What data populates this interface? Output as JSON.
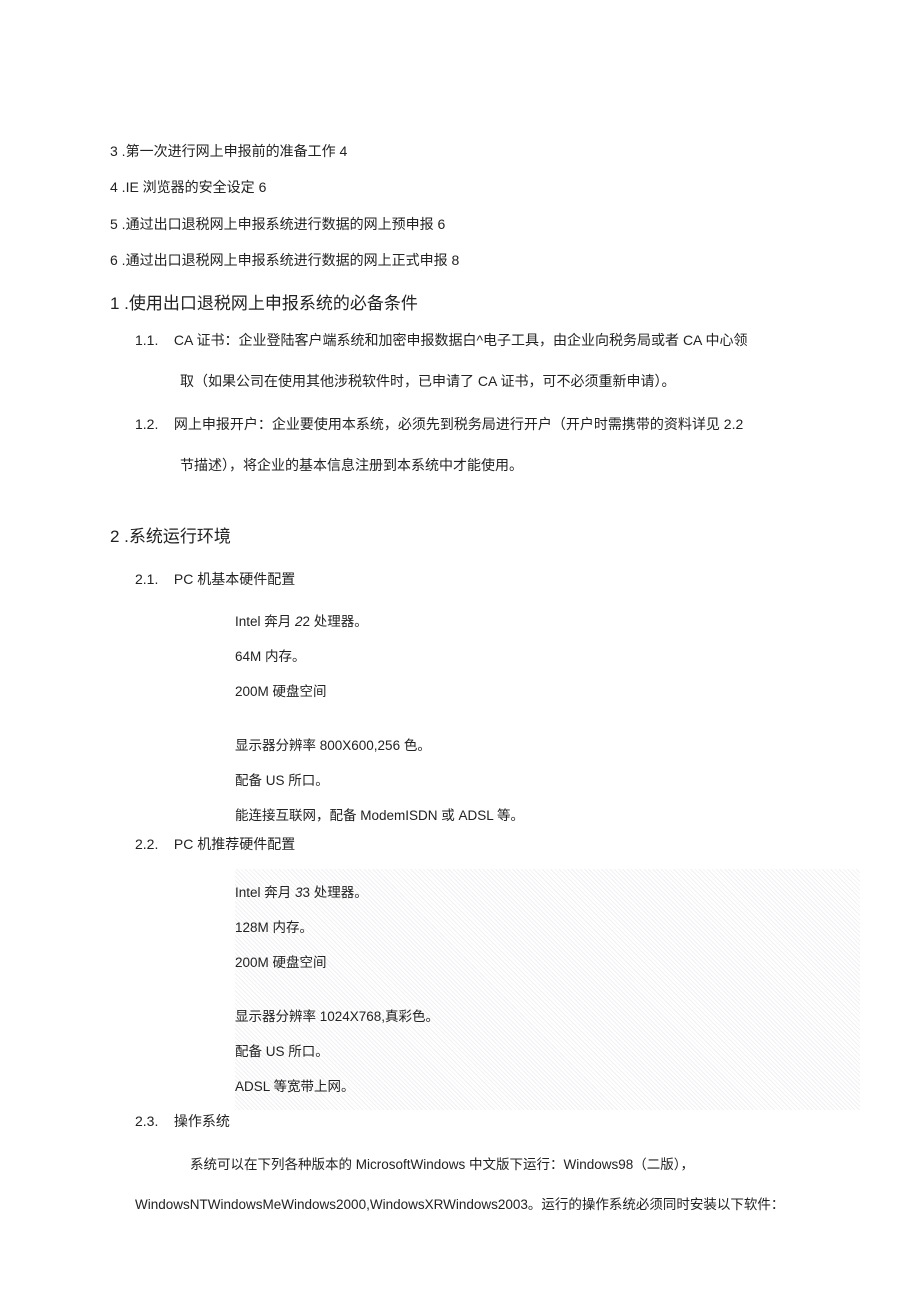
{
  "toc": {
    "item3": "3 .第一次进行网上申报前的准备工作 4",
    "item4": "4 .IE 浏览器的安全设定 6",
    "item5": "5 .通过出口退税网上申报系统进行数据的网上预申报 6",
    "item6": "6 .通过出口退税网上申报系统进行数据的网上正式申报 8"
  },
  "s1": {
    "title": "1 .使用出口退税网上申报系统的必备条件",
    "p1_label": "1.1.",
    "p1_text": "CA 证书：企业登陆客户端系统和加密申报数据白^电子工具，由企业向税务局或者 CA 中心领",
    "p1_cont": "取（如果公司在使用其他涉税软件时，已申请了 CA 证书，可不必须重新申请）。",
    "p2_label": "1.2.",
    "p2_text": "网上申报开户：企业要使用本系统，必须先到税务局进行开户（开户时需携带的资料详见 2.2",
    "p2_cont": "节描述），将企业的基本信息注册到本系统中才能使用。"
  },
  "s2": {
    "title": "2 .系统运行环境",
    "s21_label": "2.1.",
    "s21_title": "PC 机基本硬件配置",
    "s21_items": {
      "a_pre": "Intel 奔月 ",
      "a_num": "2",
      "a_post": "2 处理器。",
      "b": "64M 内存。",
      "c": "200M 硬盘空间",
      "d": "显示器分辨率 800X600,256 色。",
      "e": "配备 US 所口。",
      "f": "能连接互联网，配备 ModemISDN 或 ADSL 等。"
    },
    "s22_label": "2.2.",
    "s22_title": "PC 机推荐硬件配置",
    "s22_items": {
      "a_pre": "Intel 奔月 ",
      "a_num": "3",
      "a_post": "3 处理器。",
      "b": "128M 内存。",
      "c": "200M 硬盘空间",
      "d": "显示器分辨率 1024X768,真彩色。",
      "e": "配备 US 所口。",
      "f": "ADSL 等宽带上网。"
    },
    "s23_label": "2.3.",
    "s23_title": "操作系统",
    "s23_p1": "系统可以在下列各种版本的 MicrosoftWindows 中文版下运行：Windows98（二版），",
    "s23_p2": "WindowsNTWindowsMeWindows2000,WindowsXRWindows2003。运行的操作系统必须同时安装以下软件："
  }
}
